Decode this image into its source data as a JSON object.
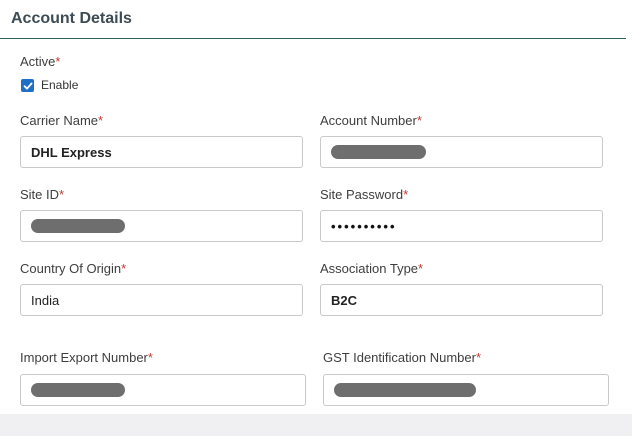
{
  "section": {
    "title": "Account Details"
  },
  "active": {
    "label": "Active",
    "required": "*",
    "checkbox_label": "Enable",
    "checked": true
  },
  "fields": {
    "carrier_name": {
      "label": "Carrier Name",
      "required": "*",
      "value": "DHL Express"
    },
    "account_number": {
      "label": "Account Number",
      "required": "*",
      "value": "",
      "redacted": true
    },
    "site_id": {
      "label": "Site ID",
      "required": "*",
      "value": "",
      "redacted": true
    },
    "site_password": {
      "label": "Site Password",
      "required": "*",
      "masked_value": "••••••••••"
    },
    "country_of_origin": {
      "label": "Country Of Origin",
      "required": "*",
      "value": "India"
    },
    "association_type": {
      "label": "Association Type",
      "required": "*",
      "value": "B2C"
    },
    "import_export_number": {
      "label": "Import Export Number",
      "required": "*",
      "value": "",
      "redacted": true
    },
    "gst_identification_number": {
      "label": "GST Identification Number",
      "required": "*",
      "value": "",
      "redacted": true
    }
  },
  "colors": {
    "accent": "#1f6fc5",
    "required": "#c23934",
    "header_rule": "#2f5f58"
  }
}
